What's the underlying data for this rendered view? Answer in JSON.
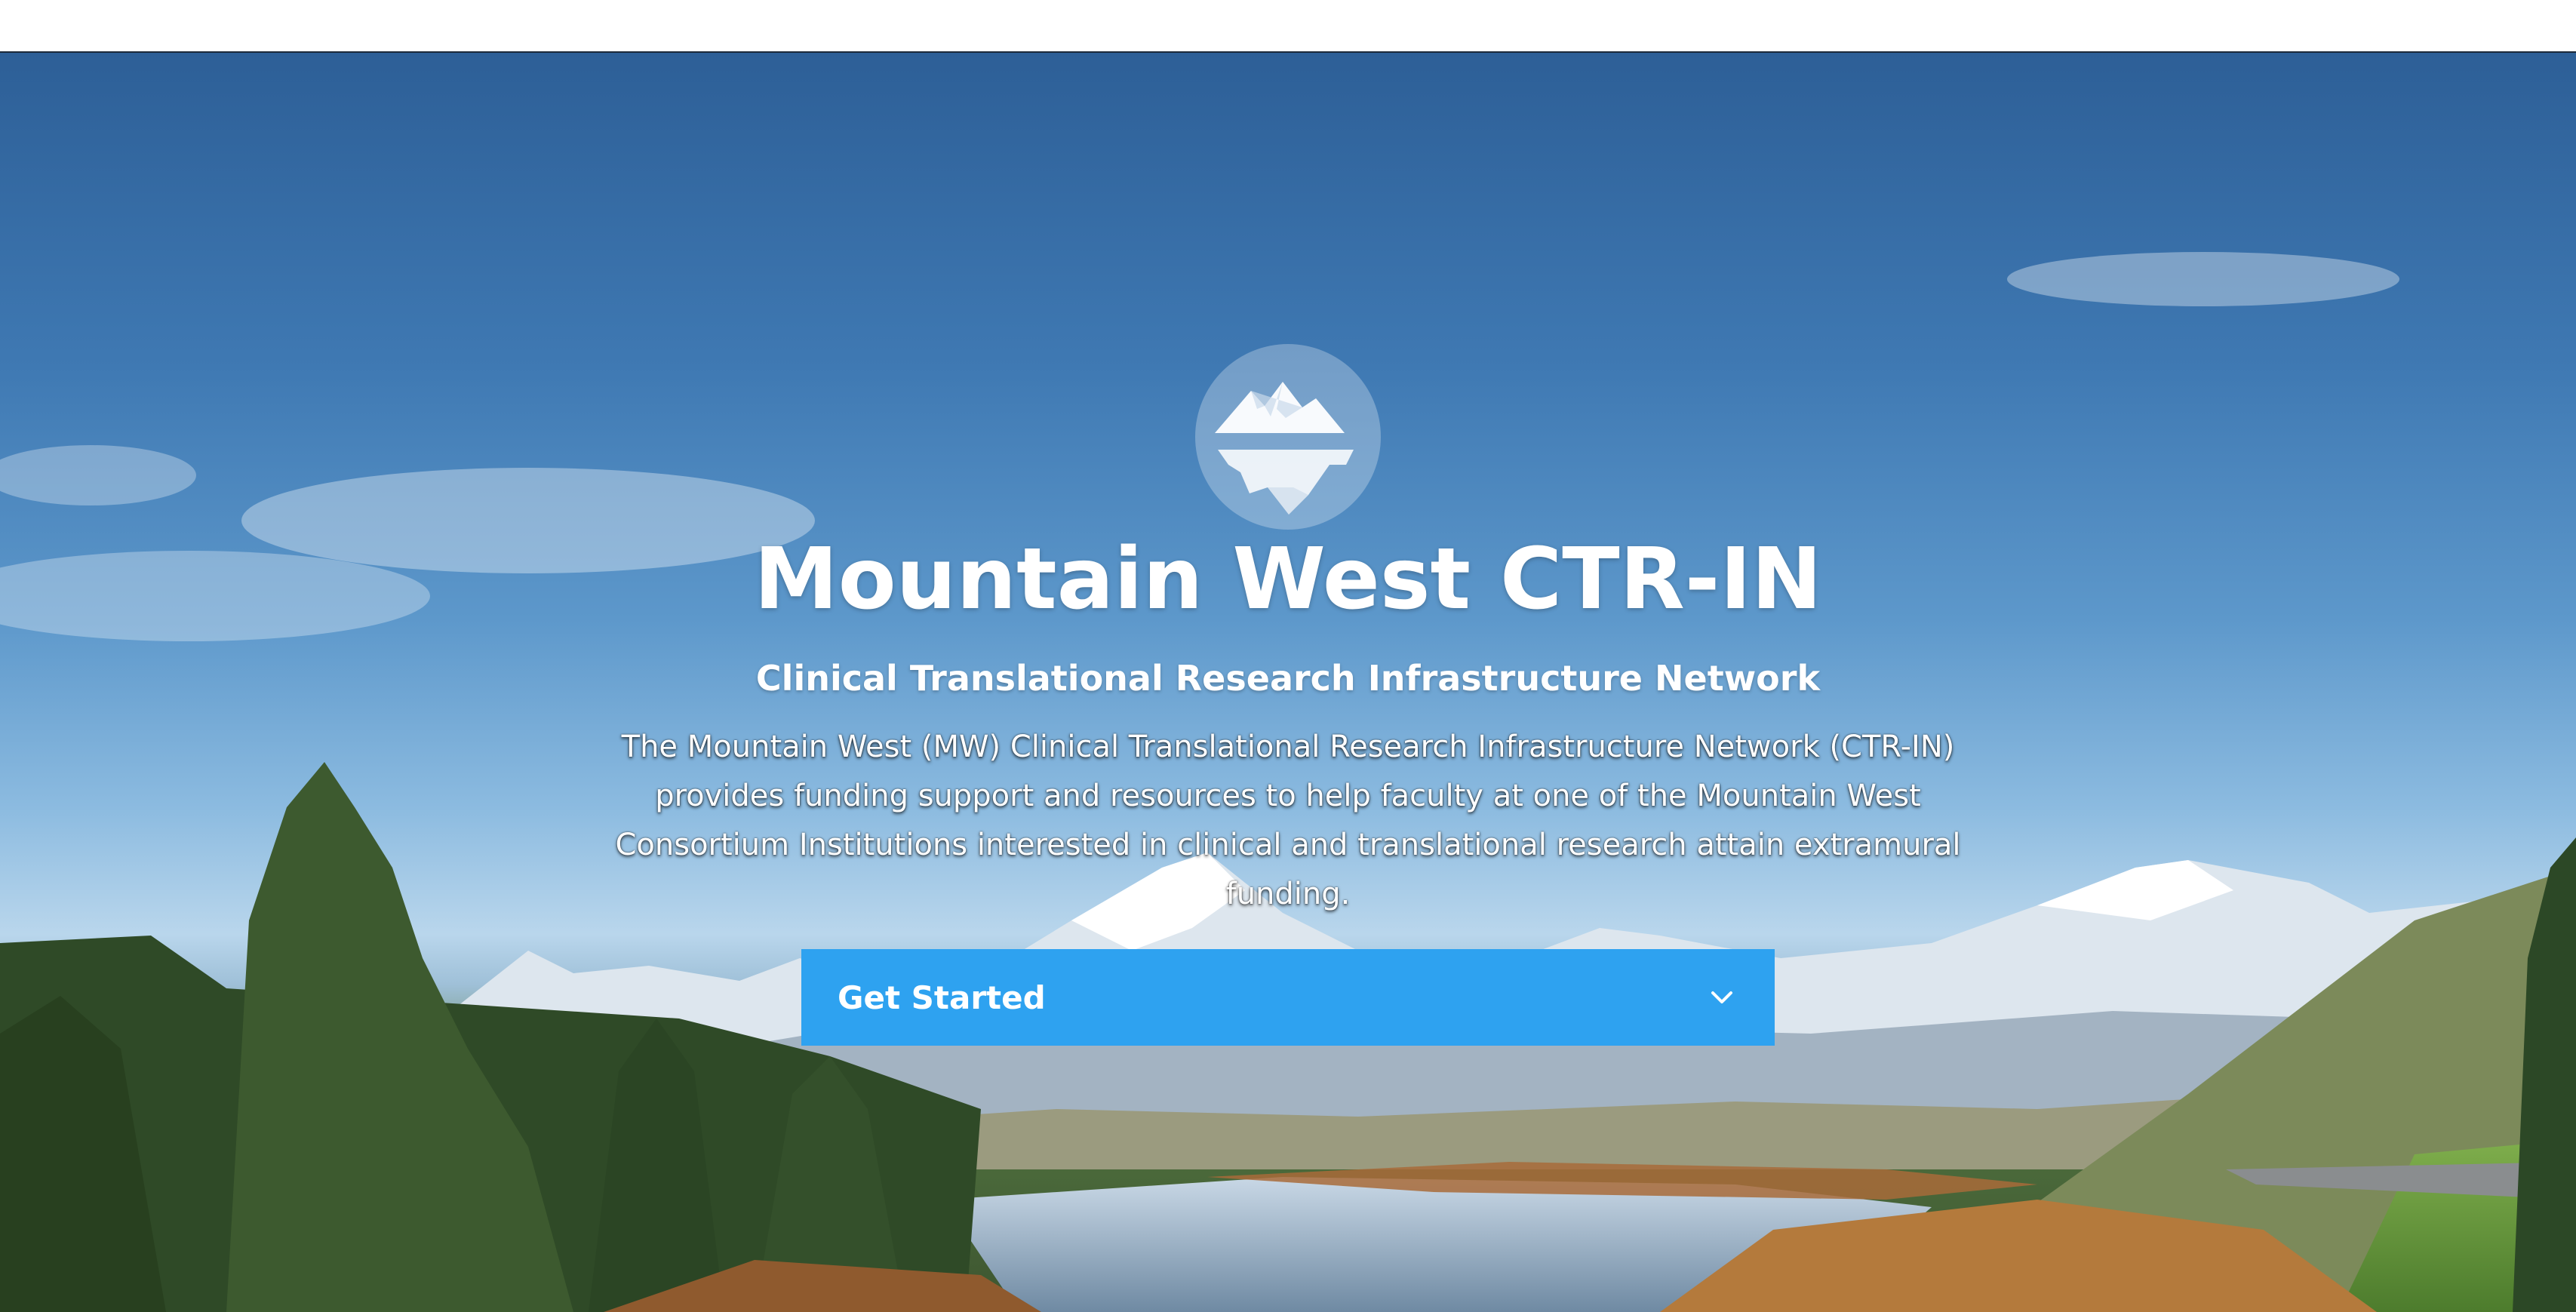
{
  "hero": {
    "title": "Mountain West CTR-IN",
    "subtitle": "Clinical Translational Research Infrastructure Network",
    "description": "The Mountain West (MW) Clinical Translational Research Infrastructure Network (CTR-IN) provides funding support and resources to help faculty at one of the Mountain West Consortium Institutions interested in clinical and translational research attain extramural funding.",
    "cta_label": "Get Started",
    "cta_icon": "chevron-down-icon",
    "logo_icon": "mountain-reflection-logo"
  },
  "colors": {
    "cta_background": "#2ea2f0",
    "text": "#ffffff",
    "sky_top": "#2d5f97"
  }
}
